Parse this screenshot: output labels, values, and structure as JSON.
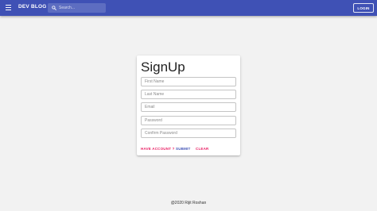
{
  "appbar": {
    "title": "DEV BLOG",
    "menu_icon": "menu-icon",
    "search_icon": "search-icon",
    "search_placeholder": "Search...",
    "login_label": "LOGIN",
    "bg_color": "#3f51b5"
  },
  "signup": {
    "title": "SignUp",
    "fields": {
      "first_name": "First Name",
      "last_name": "Last Name",
      "email": "Email",
      "password": "Password",
      "confirm_password": "Confirm Password"
    },
    "have_account_label": "HAVE ACCOUNT ?",
    "submit_label": "SUBMIT",
    "clear_label": "CLEAR",
    "accent_secondary": "#e91e63",
    "accent_primary": "#3f51b5"
  },
  "footer": {
    "text": "@2020 Rijit Roshan"
  }
}
